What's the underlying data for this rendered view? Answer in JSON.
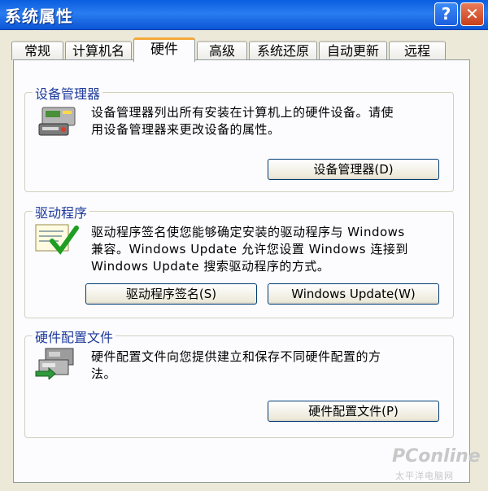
{
  "window": {
    "title": "系统属性",
    "help_label": "?",
    "close_label": "✕"
  },
  "tabs": [
    {
      "label": "常规",
      "active": false
    },
    {
      "label": "计算机名",
      "active": false
    },
    {
      "label": "硬件",
      "active": true
    },
    {
      "label": "高级",
      "active": false
    },
    {
      "label": "系统还原",
      "active": false
    },
    {
      "label": "自动更新",
      "active": false
    },
    {
      "label": "远程",
      "active": false
    }
  ],
  "device_manager": {
    "title": "设备管理器",
    "desc_line1": "设备管理器列出所有安装在计算机上的硬件设备。请使",
    "desc_line2": "用设备管理器来更改设备的属性。",
    "button": "设备管理器(D)",
    "icon": "device-manager-icon"
  },
  "drivers": {
    "title": "驱动程序",
    "desc_line1": "驱动程序签名使您能够确定安装的驱动程序与 Windows",
    "desc_line2": "兼容。Windows Update 允许您设置 Windows 连接到",
    "desc_line3": "Windows Update 搜索驱动程序的方式。",
    "sign_button": "驱动程序签名(S)",
    "update_button": "Windows Update(W)",
    "icon": "driver-signing-icon"
  },
  "profiles": {
    "title": "硬件配置文件",
    "desc_line1": "硬件配置文件向您提供建立和保存不同硬件配置的方",
    "desc_line2": "法。",
    "button": "硬件配置文件(P)",
    "icon": "hardware-profile-icon"
  },
  "watermark": {
    "brand": "PConline",
    "sub": "太平洋电脑网"
  }
}
